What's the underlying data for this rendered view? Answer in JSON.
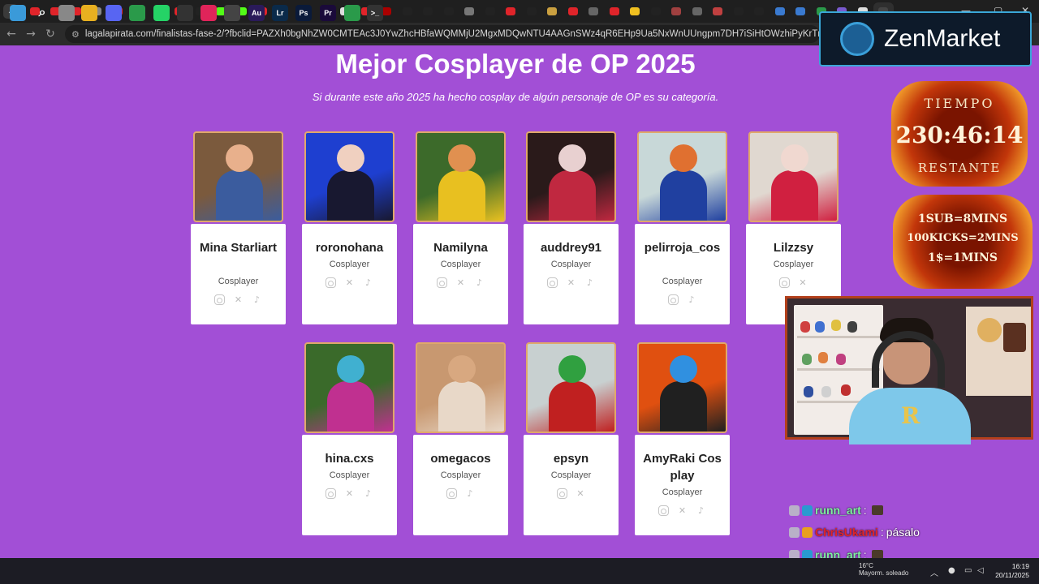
{
  "browser": {
    "url": "lagalapirata.com/finalistas-fase-2/?fbclid=PAZXh0bgNhZW0CMTEAc3J0YwZhcHBfaWQMMjU2MgxMDQwNTU4AAGnSWz4qR6EHp9Ua5NxWnUUngpm7DH7iSiHtOWzhiPyKrTm1Qu9j0dLZJr0-LU_aem_Pg2NvrL9HEgrUpR..."
  },
  "page": {
    "title": "Mejor Cosplayer de OP 2025",
    "subtitle": "Si durante este año 2025 ha hecho cosplay de algún personaje de OP es su categoría."
  },
  "finalists": [
    {
      "name": "Mina Starliart",
      "role": "Cosplayer",
      "socials": [
        "instagram-icon",
        "x-icon",
        "tiktok-icon"
      ],
      "colors": [
        "#7b5a3d",
        "#e8b08c",
        "#3b5c9e"
      ]
    },
    {
      "name": "roronohana",
      "role": "Cosplayer",
      "socials": [
        "instagram-icon",
        "x-icon",
        "tiktok-icon"
      ],
      "colors": [
        "#1e3fd0",
        "#f0d0c0",
        "#181830"
      ]
    },
    {
      "name": "Namilyna",
      "role": "Cosplayer",
      "socials": [
        "instagram-icon",
        "x-icon",
        "tiktok-icon"
      ],
      "colors": [
        "#3c6a2a",
        "#e09050",
        "#e8c020"
      ]
    },
    {
      "name": "auddrey91",
      "role": "Cosplayer",
      "socials": [
        "instagram-icon",
        "x-icon",
        "tiktok-icon"
      ],
      "colors": [
        "#2a1a1a",
        "#e8d0d0",
        "#c02840"
      ]
    },
    {
      "name": "pelirroja_cos",
      "role": "Cosplayer",
      "socials": [
        "instagram-icon",
        "tiktok-icon"
      ],
      "colors": [
        "#c8d8d8",
        "#e07030",
        "#2040a0"
      ]
    },
    {
      "name": "Lilzzsy",
      "role": "Cosplayer",
      "socials": [
        "instagram-icon",
        "x-icon"
      ],
      "colors": [
        "#e0d8d0",
        "#f0d8d0",
        "#d02040"
      ]
    },
    {
      "name": "hina.cxs",
      "role": "Cosplayer",
      "socials": [
        "instagram-icon",
        "x-icon",
        "tiktok-icon"
      ],
      "colors": [
        "#3a6a2a",
        "#40b0d0",
        "#c03090"
      ]
    },
    {
      "name": "omegacos",
      "role": "Cosplayer",
      "socials": [
        "instagram-icon",
        "tiktok-icon"
      ],
      "colors": [
        "#c89870",
        "#d8a880",
        "#e8d8c8"
      ]
    },
    {
      "name": "epsyn",
      "role": "Cosplayer",
      "socials": [
        "instagram-icon",
        "x-icon"
      ],
      "colors": [
        "#c8d0d0",
        "#30a040",
        "#c02020"
      ]
    },
    {
      "name": "AmyRaki Cosplay",
      "role": "Cosplayer",
      "socials": [
        "instagram-icon",
        "x-icon",
        "tiktok-icon"
      ],
      "colors": [
        "#e05010",
        "#3090e0",
        "#202020"
      ]
    }
  ],
  "overlay": {
    "brand": "ZenMarket",
    "timer_label": "TIEMPO",
    "timer_value": "230:46:14",
    "timer_suffix": "RESTANTE",
    "rules": [
      "1SUB=8MINS",
      "100KICKS=2MINS",
      "1$=1MINS"
    ],
    "webcam_logo": "R"
  },
  "chat": [
    {
      "user": "runn_art",
      "sep": ":",
      "message": "",
      "user_color": "#7ef0a0"
    },
    {
      "user": "ChrisUkami",
      "sep": ":",
      "message": "pásalo",
      "user_color": "#e0242a"
    },
    {
      "user": "runn_art",
      "sep": ":",
      "message": "",
      "user_color": "#7ef0a0"
    }
  ],
  "taskbar": {
    "weather_temp": "16°C",
    "weather_desc": "Mayorm. soleado",
    "time": "16:19",
    "date": "20/11/2025"
  }
}
